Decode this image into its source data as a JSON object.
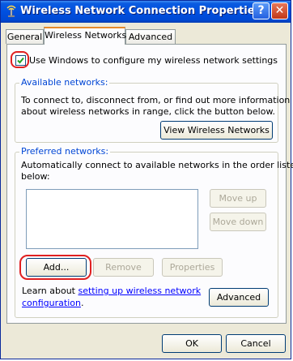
{
  "window": {
    "title": "Wireless Network Connection Properties",
    "help_button": "?",
    "close_button": "✕"
  },
  "tabs": [
    {
      "label": "General",
      "active": false
    },
    {
      "label": "Wireless Networks",
      "active": true
    },
    {
      "label": "Advanced",
      "active": false
    }
  ],
  "use_windows": {
    "label": "Use Windows to configure my wireless network settings",
    "checked": true
  },
  "available": {
    "title": "Available networks:",
    "text_line1": "To connect to, disconnect from, or find out more information",
    "text_line2": "about wireless networks in range, click the button below.",
    "view_button": "View Wireless Networks"
  },
  "preferred": {
    "title": "Preferred networks:",
    "text_line1": "Automatically connect to available networks in the order listed",
    "text_line2": "below:",
    "move_up": "Move up",
    "move_down": "Move down",
    "add": "Add...",
    "remove": "Remove",
    "properties": "Properties",
    "learn_prefix": "Learn about ",
    "learn_link_line1": "setting up wireless network",
    "learn_link_line2": "configuration",
    "learn_suffix": ".",
    "advanced": "Advanced"
  },
  "footer": {
    "ok": "OK",
    "cancel": "Cancel"
  },
  "colors": {
    "title_bar": "#0050e0",
    "accent_tab": "#e68b2c",
    "highlight_circle": "#e02020",
    "group_title": "#0046d5",
    "link": "#0000ff"
  }
}
